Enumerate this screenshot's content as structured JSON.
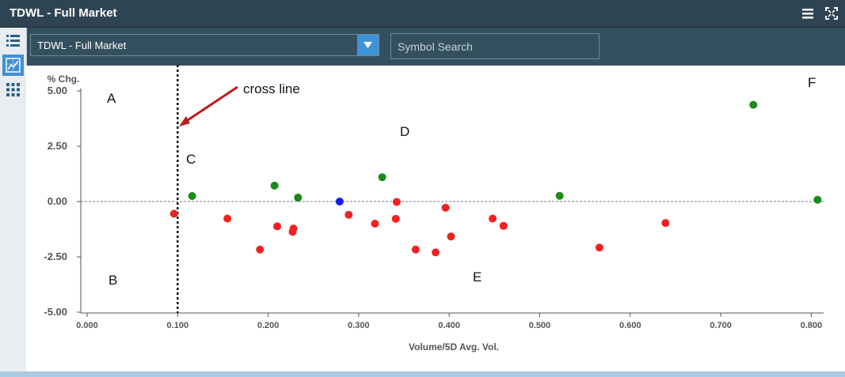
{
  "window": {
    "title": "TDWL - Full Market"
  },
  "toolbar": {
    "market_select": "TDWL - Full Market",
    "search_placeholder": "Symbol Search"
  },
  "colors": {
    "title_bar": "#2f4453",
    "toolbar": "#34505e",
    "accent": "#3f94d8",
    "up": "#1a8a1a",
    "down": "#ee2222",
    "unchanged": "#1a1aee"
  },
  "annotations": {
    "cross_line_label": "cross line",
    "region_a": "A",
    "region_b": "B",
    "region_c": "C",
    "region_d": "D",
    "region_e": "E",
    "region_f": "F"
  },
  "chart_data": {
    "type": "scatter",
    "title": "",
    "xlabel": "Volume/5D Avg. Vol.",
    "ylabel": "% Chg.",
    "xlim": [
      -0.01,
      0.81
    ],
    "ylim": [
      -5.0,
      5.0
    ],
    "x_ticks": [
      "0.000",
      "0.100",
      "0.200",
      "0.300",
      "0.400",
      "0.500",
      "0.600",
      "0.700",
      "0.800"
    ],
    "y_ticks": [
      "5.00",
      "2.50",
      "0.00",
      "-2.50",
      "-5.00"
    ],
    "cross_line_x": 0.1,
    "zero_line_y": 0,
    "points": [
      {
        "x": 0.116,
        "y": 0.25,
        "status": "up"
      },
      {
        "x": 0.207,
        "y": 0.72,
        "status": "up"
      },
      {
        "x": 0.233,
        "y": 0.18,
        "status": "up"
      },
      {
        "x": 0.326,
        "y": 1.1,
        "status": "up"
      },
      {
        "x": 0.522,
        "y": 0.26,
        "status": "up"
      },
      {
        "x": 0.736,
        "y": 4.37,
        "status": "up"
      },
      {
        "x": 0.807,
        "y": 0.08,
        "status": "up"
      },
      {
        "x": 0.279,
        "y": 0.0,
        "status": "unchanged"
      },
      {
        "x": 0.096,
        "y": -0.55,
        "status": "down"
      },
      {
        "x": 0.155,
        "y": -0.77,
        "status": "down"
      },
      {
        "x": 0.191,
        "y": -2.17,
        "status": "down"
      },
      {
        "x": 0.21,
        "y": -1.12,
        "status": "down"
      },
      {
        "x": 0.227,
        "y": -1.37,
        "status": "down"
      },
      {
        "x": 0.228,
        "y": -1.22,
        "status": "down"
      },
      {
        "x": 0.289,
        "y": -0.6,
        "status": "down"
      },
      {
        "x": 0.318,
        "y": -1.0,
        "status": "down"
      },
      {
        "x": 0.341,
        "y": -0.78,
        "status": "down"
      },
      {
        "x": 0.342,
        "y": -0.02,
        "status": "down"
      },
      {
        "x": 0.363,
        "y": -2.17,
        "status": "down"
      },
      {
        "x": 0.385,
        "y": -2.3,
        "status": "down"
      },
      {
        "x": 0.396,
        "y": -0.28,
        "status": "down"
      },
      {
        "x": 0.402,
        "y": -1.58,
        "status": "down"
      },
      {
        "x": 0.448,
        "y": -0.77,
        "status": "down"
      },
      {
        "x": 0.46,
        "y": -1.1,
        "status": "down"
      },
      {
        "x": 0.566,
        "y": -2.08,
        "status": "down"
      },
      {
        "x": 0.639,
        "y": -0.97,
        "status": "down"
      }
    ]
  }
}
